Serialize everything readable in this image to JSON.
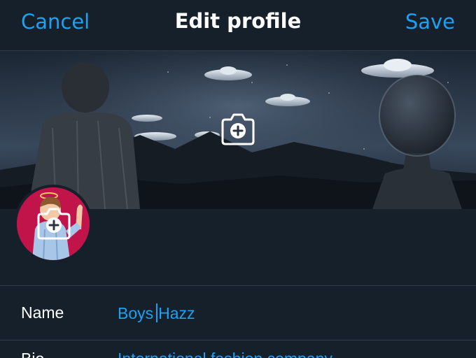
{
  "nav": {
    "cancel_label": "Cancel",
    "title": "Edit profile",
    "save_label": "Save"
  },
  "header": {
    "camera_icon": "camera-plus-icon"
  },
  "avatar": {
    "camera_icon": "camera-plus-icon"
  },
  "fields": {
    "name": {
      "label": "Name",
      "value_before_cursor": "Boys",
      "value_after_cursor": "Hazz"
    },
    "bio": {
      "label": "Bio",
      "value": "International fashion company"
    }
  },
  "colors": {
    "background": "#15202b",
    "accent": "#1da1f2",
    "divider": "#2f3d4a",
    "text": "#ffffff"
  }
}
